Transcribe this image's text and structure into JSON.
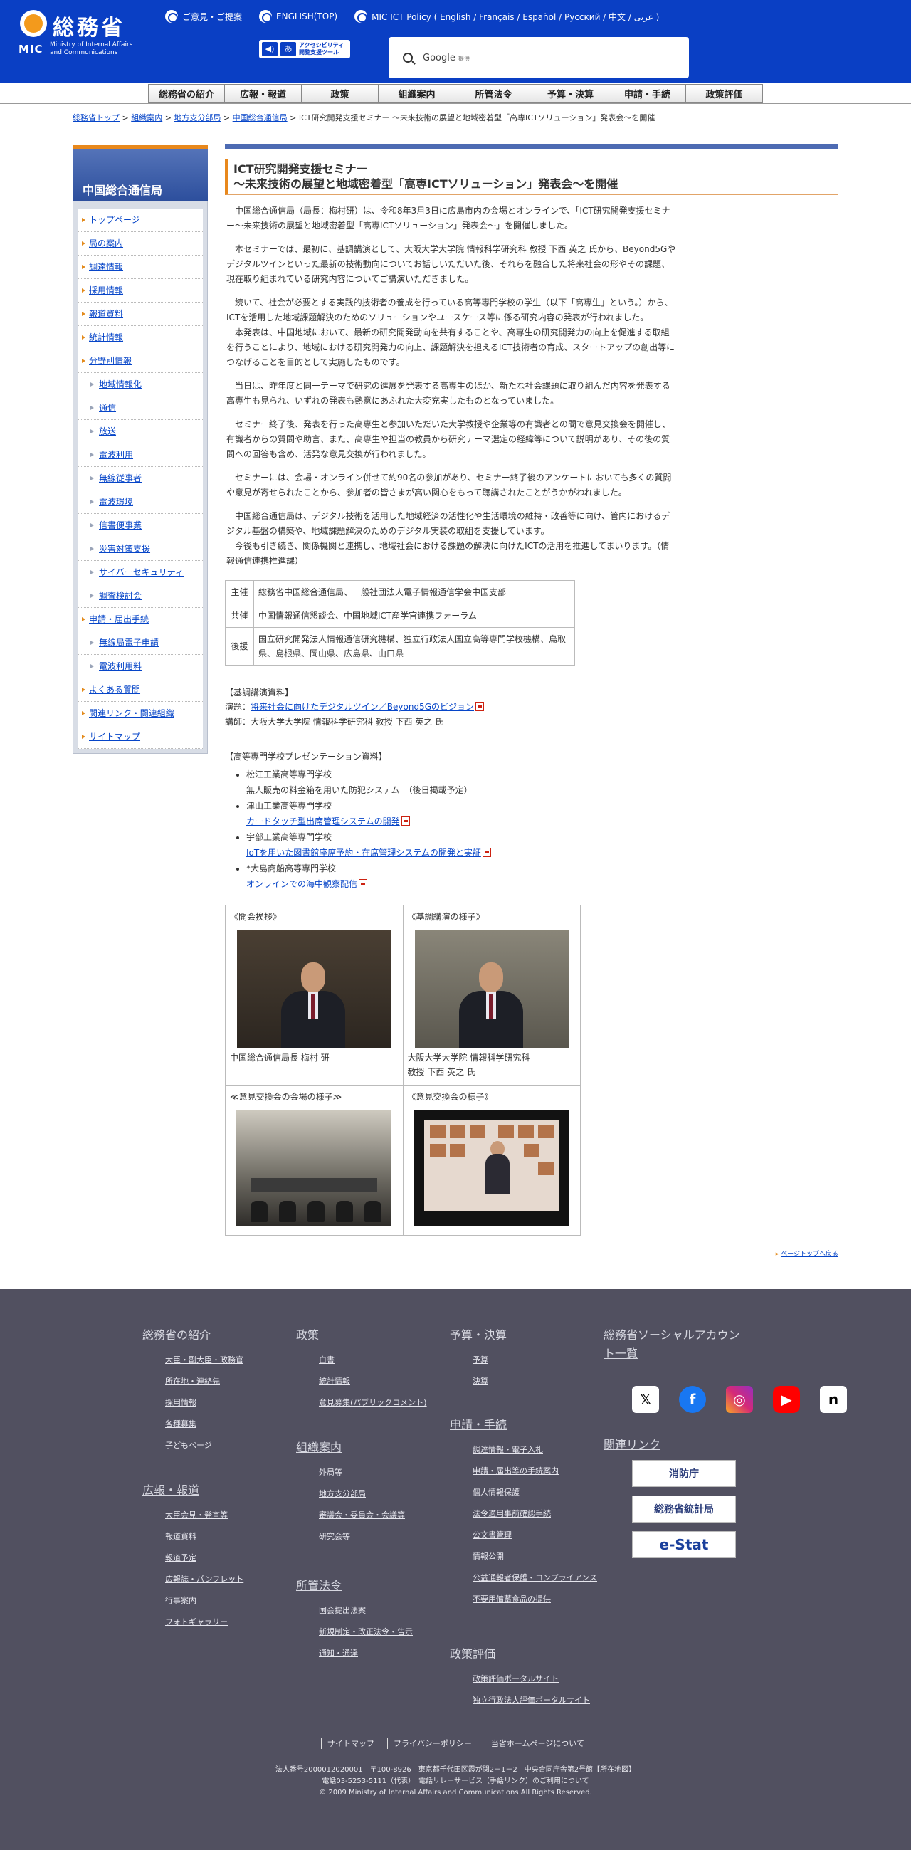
{
  "header": {
    "logo_text": "総務省",
    "logo_mic": "MIC",
    "logo_en_1": "Ministry of Internal Affairs",
    "logo_en_2": "and Communications",
    "top_links": [
      "ご意見・ご提案",
      "ENGLISH(TOP)",
      "MIC ICT Policy ( English / Français / Español / Русский / 中文 / عربى )"
    ],
    "accessibility_label_1": "アクセシビリティ",
    "accessibility_label_2": "閲覧支援ツール",
    "search_brand": "Google",
    "search_suffix": "提供"
  },
  "gnav": [
    "総務省の紹介",
    "広報・報道",
    "政策",
    "組織案内",
    "所管法令",
    "予算・決算",
    "申請・手続",
    "政策評価"
  ],
  "breadcrumb": {
    "links": [
      "総務省トップ",
      "組織案内",
      "地方支分部局",
      "中国総合通信局"
    ],
    "current": "ICT研究開発支援セミナー ～未来技術の展望と地域密着型「高専ICTソリューション」発表会～を開催"
  },
  "sidebar": {
    "title": "中国総合通信局",
    "items": [
      {
        "label": "トップページ",
        "sub": false
      },
      {
        "label": "局の案内",
        "sub": false
      },
      {
        "label": "調達情報",
        "sub": false
      },
      {
        "label": "採用情報",
        "sub": false
      },
      {
        "label": "報道資料",
        "sub": false
      },
      {
        "label": "統計情報",
        "sub": false
      },
      {
        "label": "分野別情報",
        "sub": false
      },
      {
        "label": "地域情報化",
        "sub": true
      },
      {
        "label": "通信",
        "sub": true
      },
      {
        "label": "放送",
        "sub": true
      },
      {
        "label": "電波利用",
        "sub": true
      },
      {
        "label": "無線従事者",
        "sub": true
      },
      {
        "label": "電波環境",
        "sub": true
      },
      {
        "label": "信書便事業",
        "sub": true
      },
      {
        "label": "災害対策支援",
        "sub": true
      },
      {
        "label": "サイバーセキュリティ",
        "sub": true
      },
      {
        "label": "調査検討会",
        "sub": true
      },
      {
        "label": "申請・届出手続",
        "sub": false
      },
      {
        "label": "無線局電子申請",
        "sub": true
      },
      {
        "label": "電波利用料",
        "sub": true
      },
      {
        "label": "よくある質問",
        "sub": false
      },
      {
        "label": "関連リンク・関連組織",
        "sub": false
      },
      {
        "label": "サイトマップ",
        "sub": false
      }
    ]
  },
  "article": {
    "title_1": "ICT研究開発支援セミナー",
    "title_2": "～未来技術の展望と地域密着型「高専ICTソリューション」発表会～を開催",
    "p1": "中国総合通信局（局長：梅村研）は、令和8年3月3日に広島市内の会場とオンラインで、「ICT研究開発支援セミナー～未来技術の展望と地域密着型「高専ICTソリューション」発表会～」を開催しました。",
    "p2": "本セミナーでは、最初に、基調講演として、大阪大学大学院 情報科学研究科 教授 下西 英之 氏から、Beyond5Gやデジタルツインといった最新の技術動向についてお話しいただいた後、それらを融合した将来社会の形やその課題、現在取り組まれている研究内容についてご講演いただきました。",
    "p3": "続いて、社会が必要とする実践的技術者の養成を行っている高等専門学校の学生（以下「高専生」という。）から、ICTを活用した地域課題解決のためのソリューションやユースケース等に係る研究内容の発表が行われました。",
    "p4": "本発表は、中国地域において、最新の研究開発動向を共有することや、高専生の研究開発力の向上を促進する取組を行うことにより、地域における研究開発力の向上、課題解決を担えるICT技術者の育成、スタートアップの創出等につなげることを目的として実施したものです。",
    "p5": "当日は、昨年度と同一テーマで研究の進展を発表する高専生のほか、新たな社会課題に取り組んだ内容を発表する高専生も見られ、いずれの発表も熱意にあふれた大変充実したものとなっていました。",
    "p6": "セミナー終了後、発表を行った高専生と参加いただいた大学教授や企業等の有識者との間で意見交換会を開催し、有識者からの質問や助言、また、高専生や担当の教員から研究テーマ選定の経緯等について説明があり、その後の質問への回答も含め、活発な意見交換が行われました。",
    "p7": "セミナーには、会場・オンライン併せて約90名の参加があり、セミナー終了後のアンケートにおいても多くの質問や意見が寄せられたことから、参加者の皆さまが高い関心をもって聴講されたことがうかがわれました。",
    "p8": "中国総合通信局は、デジタル技術を活用した地域経済の活性化や生活環境の維持・改善等に向け、管内におけるデジタル基盤の構築や、地域課題解決のためのデジタル実装の取組を支援しています。",
    "p9": "今後も引き続き、関係機関と連携し、地域社会における課題の解決に向けたICTの活用を推進してまいります。（情報通信連携推進課）"
  },
  "info_table": [
    {
      "head": "主催",
      "value": "総務省中国総合通信局、一般社団法人電子情報通信学会中国支部"
    },
    {
      "head": "共催",
      "value": "中国情報通信懇談会、中国地域ICT産学官連携フォーラム"
    },
    {
      "head": "後援",
      "value": "国立研究開発法人情報通信研究機構、独立行政法人国立高等専門学校機構、鳥取県、島根県、岡山県、広島県、山口県"
    }
  ],
  "keynote": {
    "head": "【基調講演資料】",
    "title_label": "演題：",
    "title_link": "将来社会に向けたデジタルツイン／Beyond5Gのビジョン",
    "speaker": "講師：大阪大学大学院 情報科学研究科 教授 下西 英之 氏"
  },
  "presentations": {
    "head": "【高等専門学校プレゼンテーション資料】",
    "items": [
      {
        "school": "松江工業高等専門学校",
        "title": "無人販売の料金箱を用いた防犯システム　（後日掲載予定）",
        "link": false
      },
      {
        "school": "津山工業高等専門学校",
        "title": "カードタッチ型出席管理システムの開発",
        "link": true
      },
      {
        "school": "宇部工業高等専門学校",
        "title": "IoTを用いた図書館座席予約・在席管理システムの開発と実証",
        "link": true
      },
      {
        "school": "*大島商船高等専門学校",
        "title": "オンラインでの海中観察配信",
        "link": true
      }
    ]
  },
  "photos": [
    {
      "label": "《開会挨拶》",
      "caption_1": "中国総合通信局長 梅村 研",
      "caption_2": ""
    },
    {
      "label": "《基調講演の様子》",
      "caption_1": "大阪大学大学院 情報科学研究科",
      "caption_2": "教授 下西 英之 氏"
    },
    {
      "label": "≪意見交換会の会場の様子≫",
      "caption_1": "",
      "caption_2": ""
    },
    {
      "label": "《意見交換会の様子》",
      "caption_1": "",
      "caption_2": ""
    }
  ],
  "pagetop": "ページトップへ戻る",
  "footer": {
    "col1_head": "総務省の紹介",
    "col1_links": [
      "大臣・副大臣・政務官",
      "所在地・連絡先",
      "採用情報",
      "各種募集",
      "子どもページ"
    ],
    "col1b_head": "広報・報道",
    "col1b_links": [
      "大臣会見・発言等",
      "報道資料",
      "報道予定",
      "広報誌・パンフレット",
      "行事案内",
      "フォトギャラリー"
    ],
    "col2_head": "政策",
    "col2_links": [
      "白書",
      "統計情報",
      "意見募集(パブリックコメント)"
    ],
    "col2b_head": "組織案内",
    "col2b_links": [
      "外局等",
      "地方支分部局",
      "審議会・委員会・会議等",
      "研究会等"
    ],
    "col2c_head": "所管法令",
    "col2c_links": [
      "国会提出法案",
      "新規制定・改正法令・告示",
      "通知・通達"
    ],
    "col3_head": "予算・決算",
    "col3_links": [
      "予算",
      "決算"
    ],
    "col3b_head": "申請・手続",
    "col3b_links": [
      "調達情報・電子入札",
      "申請・届出等の手続案内",
      "個人情報保護",
      "法令適用事前確認手続",
      "公文書管理",
      "情報公開",
      "公益通報者保護・コンプライアンス",
      "不要用備蓄食品の提供"
    ],
    "col3c_head": "政策評価",
    "col3c_links": [
      "政策評価ポータルサイト",
      "独立行政法人評価ポータルサイト"
    ],
    "col4_head_1": "総務省ソーシャルアカウン",
    "col4_head_2": "ト一覧",
    "col4b_head": "関連リンク",
    "banners": [
      "消防庁",
      "総務省統計局",
      "e-Stat"
    ],
    "bottom_links": [
      "サイトマップ",
      "プライバシーポリシー",
      "当省ホームページについて"
    ],
    "addr_1": "法人番号2000012020001　〒100-8926　東京都千代田区霞が関2－1－2　中央合同庁舎第2号館【所在地図】",
    "addr_2": "電話03-5253-5111（代表）　電話リレーサービス（手話リンク）のご利用について",
    "copyright": "© 2009 Ministry of Internal Affairs and Communications All Rights Reserved."
  }
}
